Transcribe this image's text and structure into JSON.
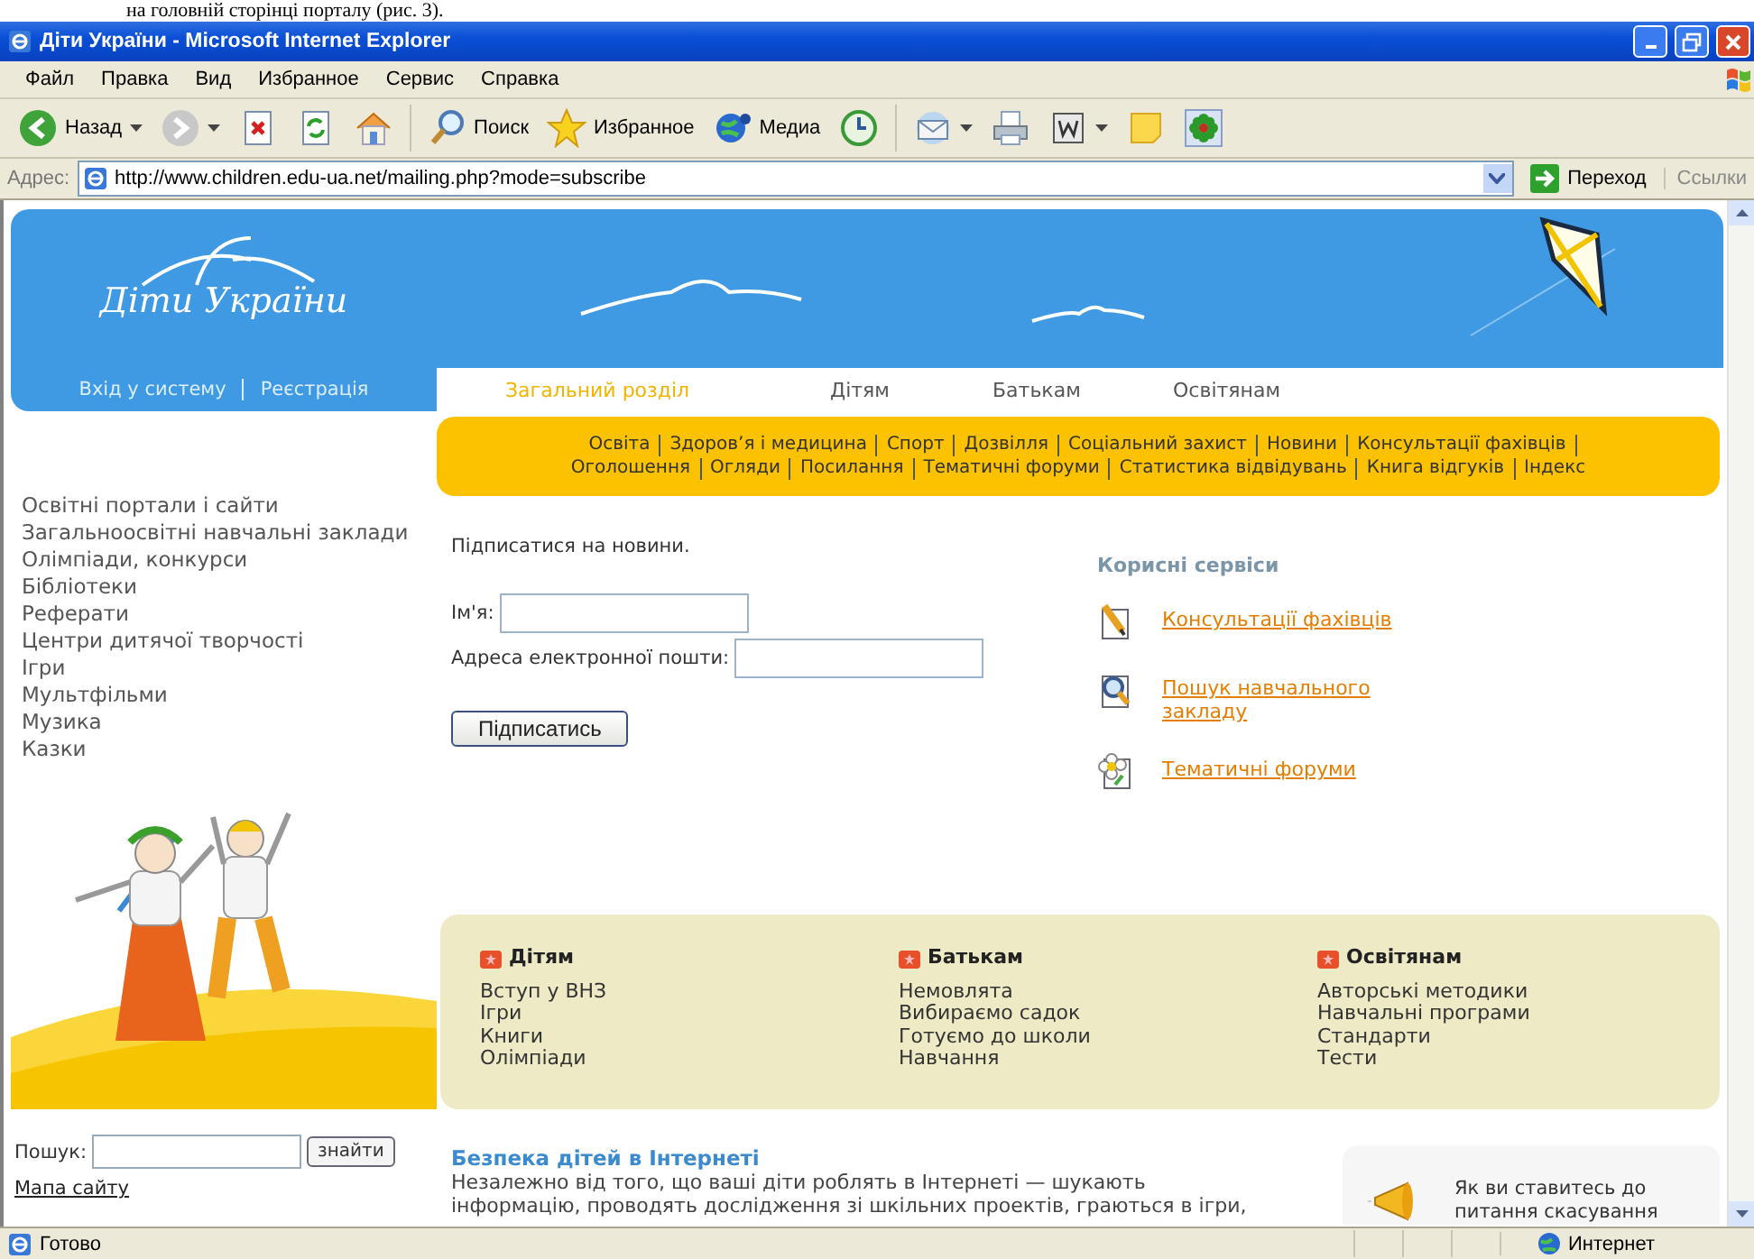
{
  "caption": "на головній сторінці порталу (рис. 3).",
  "window": {
    "title": "Діти України - Microsoft Internet Explorer"
  },
  "menu": [
    "Файл",
    "Правка",
    "Вид",
    "Избранное",
    "Сервис",
    "Справка"
  ],
  "toolbar": [
    {
      "kind": "back",
      "label": "Назад"
    },
    {
      "kind": "forward"
    },
    {
      "kind": "stop"
    },
    {
      "kind": "refresh"
    },
    {
      "kind": "home"
    },
    {
      "kind": "search",
      "label": "Поиск"
    },
    {
      "kind": "favorites",
      "label": "Избранное"
    },
    {
      "kind": "media",
      "label": "Медиа"
    },
    {
      "kind": "history"
    },
    {
      "kind": "mail"
    },
    {
      "kind": "print"
    },
    {
      "kind": "word"
    },
    {
      "kind": "note"
    },
    {
      "kind": "flower"
    }
  ],
  "address": {
    "label": "Адрес:",
    "value": "http://www.children.edu-ua.net/mailing.php?mode=subscribe",
    "go": "Переход",
    "links": "Ссылки"
  },
  "site": {
    "logo": "Діти України",
    "auth_links": [
      "Вхід у систему",
      "Реєстрація"
    ],
    "tabs": [
      {
        "label": "Загальний розділ",
        "selected": true
      },
      {
        "label": "Дітям",
        "selected": false
      },
      {
        "label": "Батькам",
        "selected": false
      },
      {
        "label": "Освітянам",
        "selected": false
      }
    ],
    "subnav": [
      [
        "Освіта",
        "Здоров’я і медицина",
        "Спорт",
        "Дозвілля",
        "Соціальний захист",
        "Новини",
        "Консультації фахівців"
      ],
      [
        "Оголошення",
        "Огляди",
        "Посилання",
        "Тематичні форуми",
        "Статистика відвідувань",
        "Книга відгуків",
        "Індекс"
      ]
    ],
    "sidebar": [
      "Освітні портали і сайти",
      "Загальноосвітні навчальні заклади",
      "Олімпіади, конкурси",
      "Бібліотеки",
      "Реферати",
      "Центри дитячої творчості",
      "Ігри",
      "Мультфільми",
      "Музика",
      "Казки"
    ],
    "form": {
      "heading": "Підписатися на новини.",
      "name_label": "Ім'я:",
      "email_label": "Адреса електронної пошти:",
      "submit": "Підписатись"
    },
    "services": {
      "title": "Корисні сервіси",
      "items": [
        {
          "kind": "pencil",
          "label": "Консультації фахівців"
        },
        {
          "kind": "magnifier",
          "label": "Пошук навчального закладу"
        },
        {
          "kind": "flower",
          "label": "Тематичні форуми"
        }
      ]
    },
    "categories": [
      {
        "title": "Дітям",
        "links": [
          "Вступ у ВНЗ",
          "Ігри",
          "Книги",
          "Олімпіади"
        ]
      },
      {
        "title": "Батькам",
        "links": [
          "Немовлята",
          "Вибираємо садок",
          "Готуємо до школи",
          "Навчання"
        ]
      },
      {
        "title": "Освітянам",
        "links": [
          "Авторські методики",
          "Навчальні програми",
          "Стандарти",
          "Тести"
        ]
      }
    ],
    "search": {
      "label": "Пошук:",
      "button": "знайти"
    },
    "sitemap": "Мапа сайту",
    "article": {
      "title": "Безпека дітей в Інтернеті",
      "lines": [
        "Незалежно від того, що ваші діти роблять в Інтернеті — шукають",
        "інформацію, проводять дослідження зі шкільних проектів, граються в ігри,"
      ]
    },
    "poll": {
      "lines": [
        "Як ви ставитесь до",
        "питання скасування"
      ]
    }
  },
  "status": {
    "text": "Готово",
    "zone": "Интернет"
  }
}
